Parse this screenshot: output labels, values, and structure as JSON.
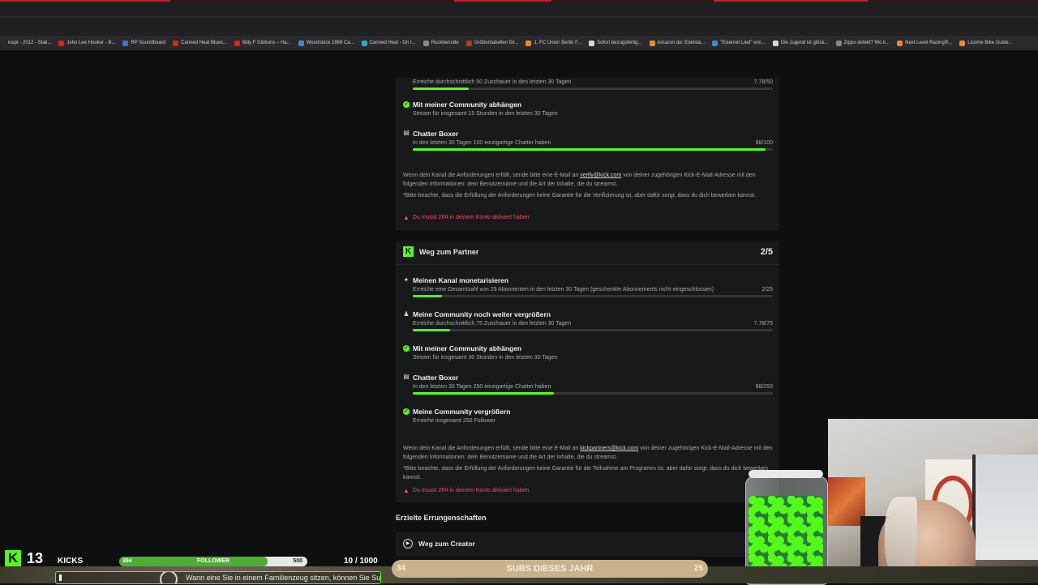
{
  "colors": {
    "accent": "#53fc18",
    "warning": "#ff4a5a",
    "card": "#17191b",
    "page": "#0e0f10"
  },
  "bookmarks": [
    {
      "label": "icept - 2012 - Stali...",
      "icon": "page-icon",
      "color": "#2a2a2d"
    },
    {
      "label": "John Lee Hooker - B...",
      "icon": "youtube-icon",
      "color": "#e62117"
    },
    {
      "label": "RP Soundboard",
      "icon": "app-icon",
      "color": "#3b74d9"
    },
    {
      "label": "Canned Heat Blues...",
      "icon": "youtube-icon",
      "color": "#e62117"
    },
    {
      "label": "Billy F Gibbons – Ha...",
      "icon": "youtube-icon",
      "color": "#e62117"
    },
    {
      "label": "Woodstock 1969 Ca...",
      "icon": "bing-icon",
      "color": "#3b8bd9"
    },
    {
      "label": "Canned Heat - On t...",
      "icon": "site-icon",
      "color": "#2aa7c9"
    },
    {
      "label": "Rockberndte",
      "icon": "globe-icon",
      "color": "#888888"
    },
    {
      "label": "Größentabellen für...",
      "icon": "site-icon",
      "color": "#c9302c"
    },
    {
      "label": "1. FC Union Berlin F...",
      "icon": "amazon-icon",
      "color": "#f08a24"
    },
    {
      "label": "Sofort bezugsfertig...",
      "icon": "site-icon",
      "color": "#d9d9d9"
    },
    {
      "label": "Amazon.de: Edelsta...",
      "icon": "amazon-icon",
      "color": "#f08a24"
    },
    {
      "label": "\"Eisernet Lied\" von...",
      "icon": "bing-icon",
      "color": "#3b8bd9"
    },
    {
      "label": "Die Jugend ist glück...",
      "icon": "site-icon",
      "color": "#d9d9d9"
    },
    {
      "label": "Zippo defekt? Wo k...",
      "icon": "globe-icon",
      "color": "#888888"
    },
    {
      "label": "Next Level Racing®...",
      "icon": "amazon-icon",
      "color": "#f08a24"
    },
    {
      "label": "Licome Bike Guide...",
      "icon": "amazon-icon",
      "color": "#f08a24"
    }
  ],
  "creator_section": {
    "requirements": [
      {
        "title": "",
        "desc": "Erreiche durchschnittlich 50 Zuschauer in den letzten 30 Tagen",
        "progress_text": "7.78/50",
        "progress": 0.1556,
        "type": "bar-only"
      },
      {
        "title": "Mit meiner Community abhängen",
        "desc": "Stream für insgesamt 15 Stunden in den letzten 30 Tagen",
        "progress_text": "",
        "type": "check"
      },
      {
        "title": "Chatter Boxer",
        "desc": "In den letzten 30 Tagen 100 einzigartige Chatter haben",
        "progress_text": "98/100",
        "progress": 0.98,
        "type": "chat"
      }
    ],
    "note_prefix": "Wenn dein Kanal die Anforderungen erfüllt, sende bitte eine E-Mail an ",
    "note_link": "verify@kick.com",
    "note_suffix": " von deiner zugehörigen Kick-E-Mail-Adresse mit den folgenden Informationen: dein Benutzername und die Art der Inhalte, die du streamst.",
    "note2": "*Bitte beachte, dass die Erfüllung der Anforderungen keine Garantie für die Verifizierung ist, aber dafür sorgt, dass du dich bewerben kannst.",
    "warning": "Du musst 2FA in deinem Konto aktiviert haben"
  },
  "partner_section": {
    "title": "Weg zum Partner",
    "count": "2/5",
    "requirements": [
      {
        "title": "Meinen Kanal monetarisieren",
        "desc": "Erreiche eine Gesamtzahl von 25 Abonnenten in den letzten 30 Tagen (geschenkte Abonnements nicht eingeschlossen)",
        "progress_text": "2/25",
        "progress": 0.08
      },
      {
        "title": "Meine Community noch weiter vergrößern",
        "desc": "Erreiche durchschnittlich 75 Zuschauer in den letzten 30 Tagen",
        "progress_text": "7.78/75",
        "progress": 0.1037
      },
      {
        "title": "Mit meiner Community abhängen",
        "desc": "Stream für insgesamt 30 Stunden in den letzten 30 Tagen",
        "progress_text": ""
      },
      {
        "title": "Chatter Boxer",
        "desc": "In den letzten 30 Tagen 250 einzigartige Chatter haben",
        "progress_text": "98/250",
        "progress": 0.392
      },
      {
        "title": "Meine Community vergrößern",
        "desc": "Erreiche insgesamt 250 Follower",
        "progress_text": ""
      }
    ],
    "note_prefix": "Wenn dein Kanal die Anforderungen erfüllt, sende bitte eine E-Mail an ",
    "note_link": "kickpartners@kick.com",
    "note_suffix": " von deiner zugehörigen Kick-E-Mail-Adresse mit den folgenden Informationen: dein Benutzername und die Art der Inhalte, die du streamst.",
    "note2": "*Bitte beachte, dass die Erfüllung der Anforderungen keine Garantie für die Teilnahme am Programm ist, aber dafür sorgt, dass du dich bewerben kannst.",
    "warning": "Du musst 2FA in deinem Konto aktiviert haben"
  },
  "achievements": {
    "heading": "Erzielte Errungenschaften",
    "item": "Weg zum Creator"
  },
  "overlay": {
    "logo": "K",
    "kick_count": "13",
    "kicks_label": "KICKS",
    "follower_current": "394",
    "follower_label": "FOLLOWER",
    "follower_goal": "500",
    "follower_progress": 0.788,
    "ratio": "10 / 1000",
    "subs_current": "34",
    "subs_label": "SUBS DIESES JAHR",
    "subs_goal": "25",
    "ticker": "Wann eine Sie in einem Familienzeug sitzen, können Sie Su"
  }
}
